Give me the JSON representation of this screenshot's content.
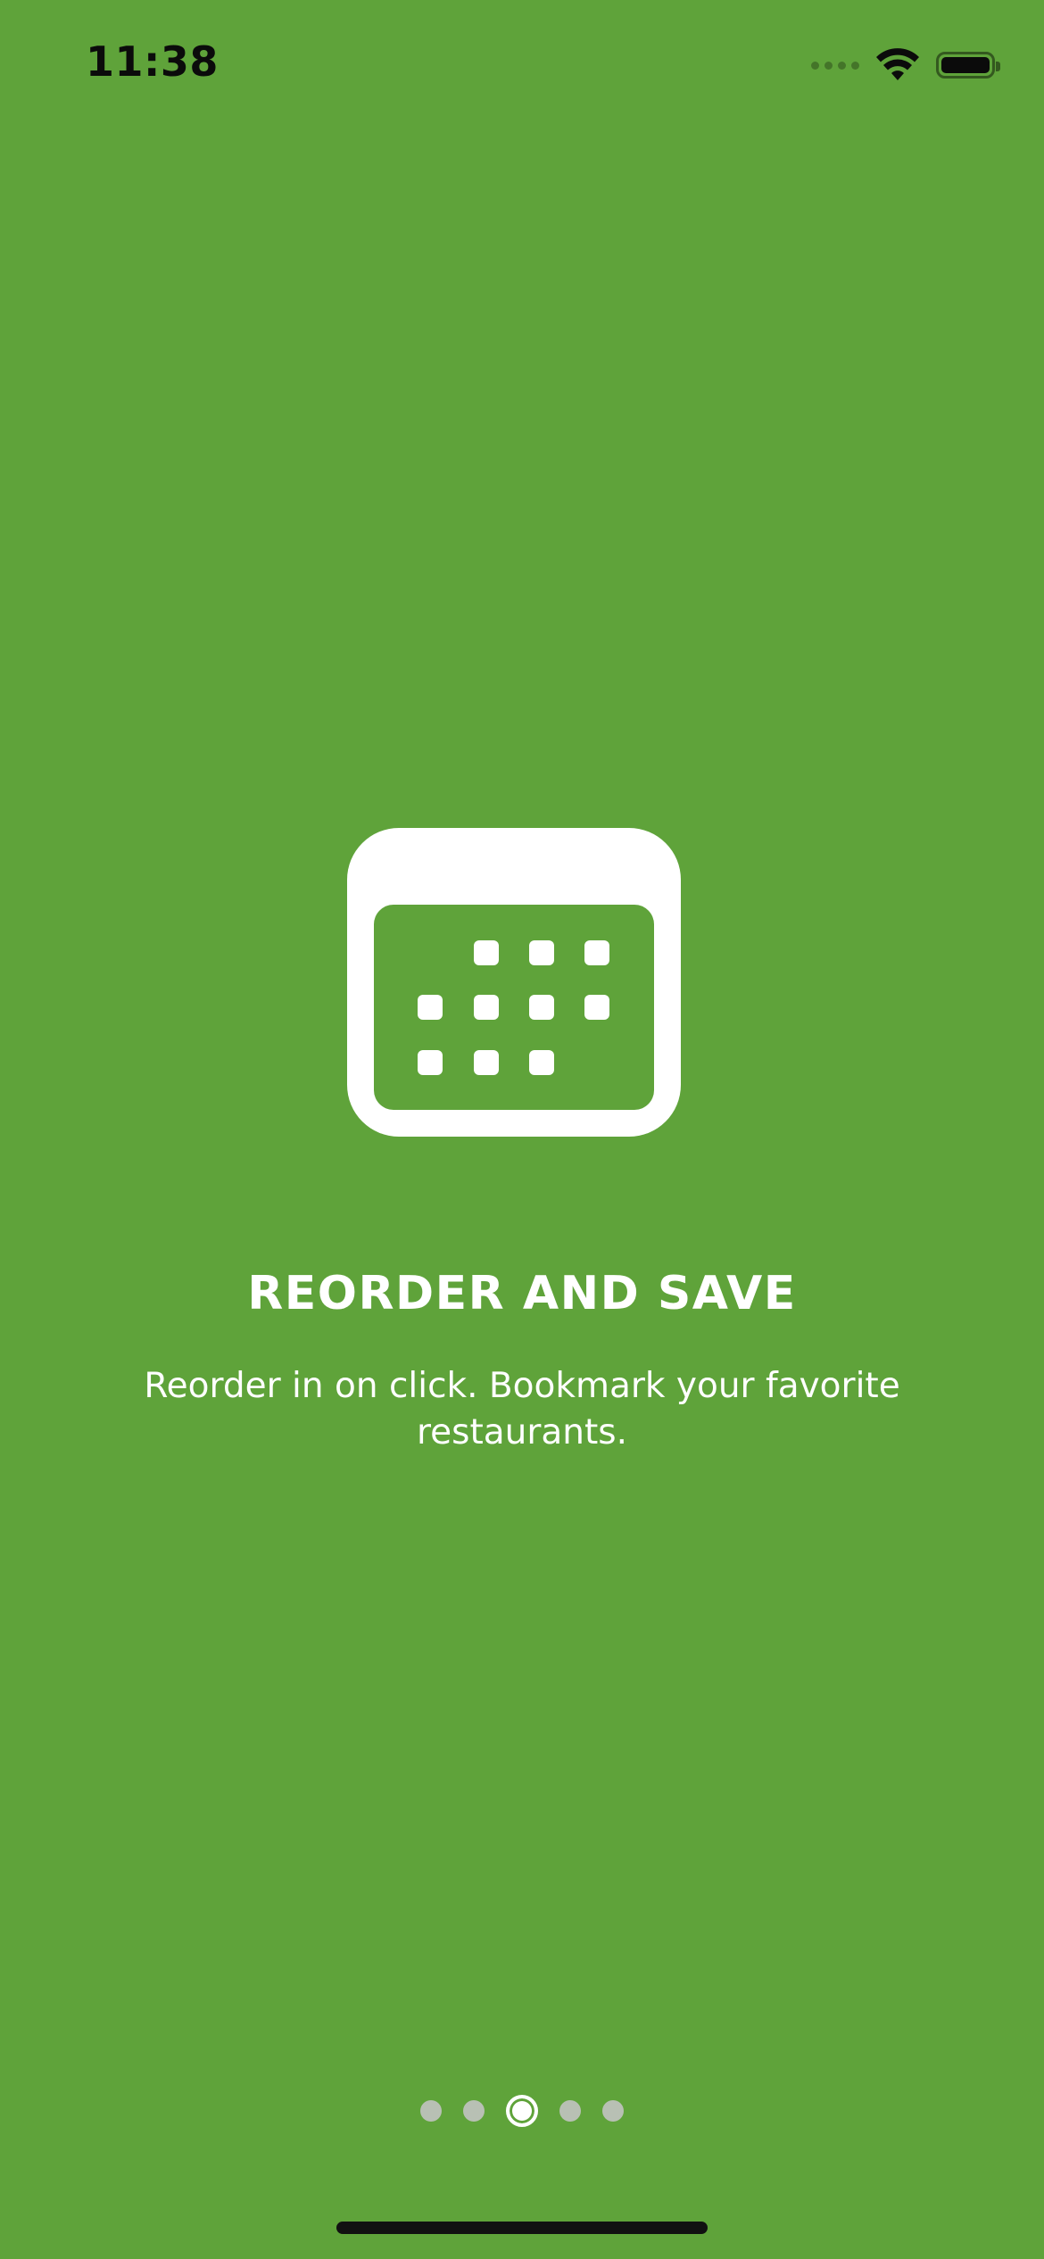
{
  "status_bar": {
    "time": "11:38",
    "icons": [
      "cellular-signal-icon",
      "wifi-icon",
      "battery-icon"
    ]
  },
  "onboarding": {
    "icon": "calendar-icon",
    "title": "REORDER AND SAVE",
    "description": "Reorder in on click. Bookmark your favorite restaurants."
  },
  "pagination": {
    "total": 5,
    "current": 3
  },
  "colors": {
    "background": "#5fa33a",
    "foreground": "#ffffff",
    "dot_inactive": "#b8c0b4"
  }
}
